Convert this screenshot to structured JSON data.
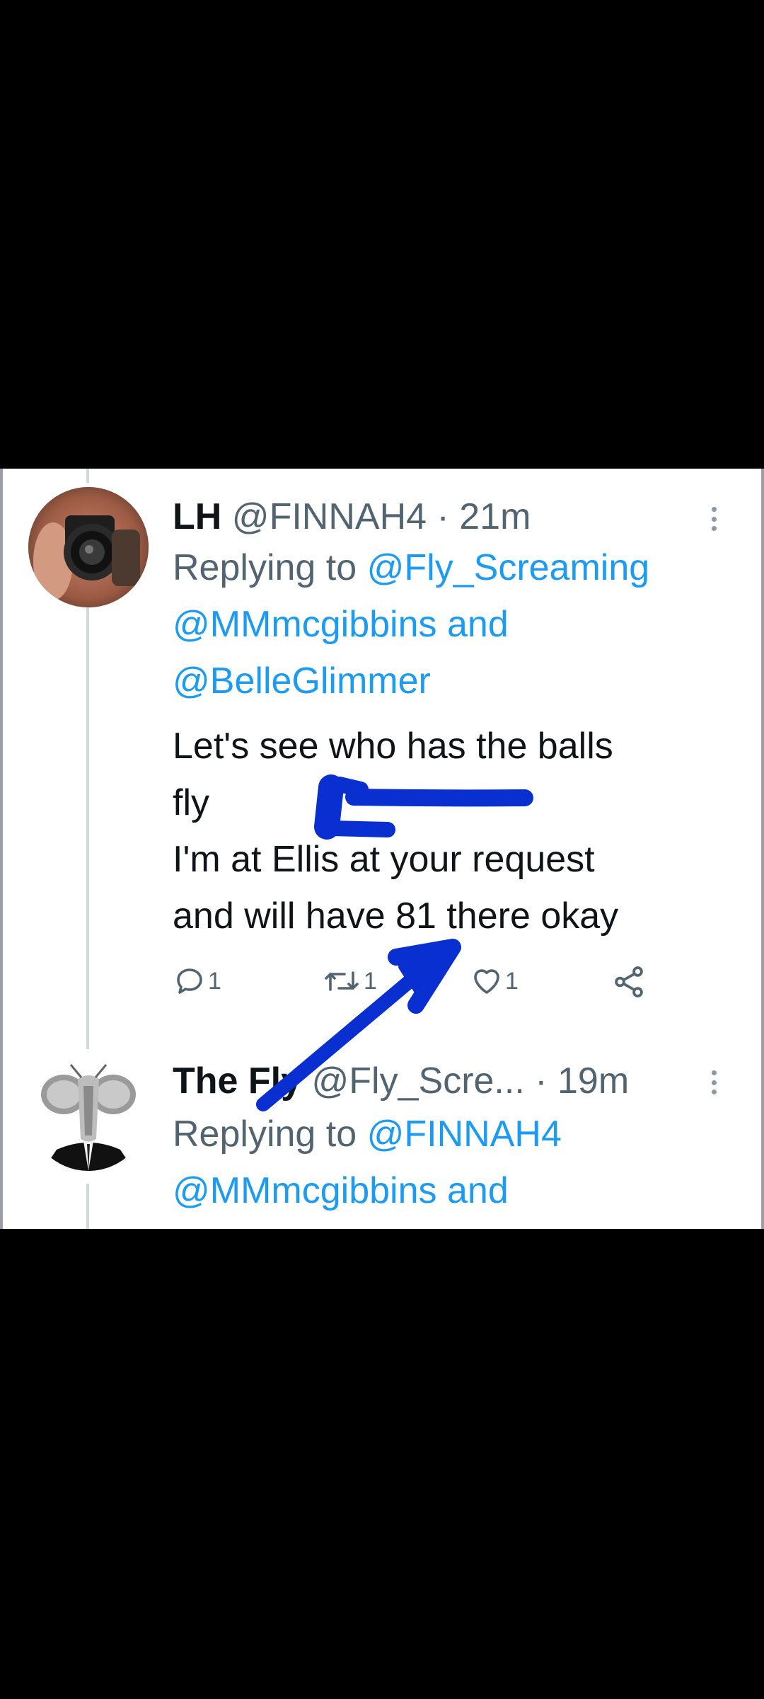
{
  "tweet1": {
    "name": "LH",
    "handle": "@FINNAH4",
    "separator": " · ",
    "time": "21m",
    "replying_prefix": "Replying to ",
    "mention_1": "@Fly_Screaming",
    "mention_2": "@MMmcgibbins",
    "and_word": " and",
    "mention_3": "@BelleGlimmer",
    "text_lines": [
      "Let's see who has the balls",
      "fly",
      "I'm at Ellis at your request",
      "and will have 81 there okay"
    ],
    "reply_count": "1",
    "retweet_count": "1",
    "like_count": "1"
  },
  "tweet2": {
    "name": "The Fly",
    "handle": "@Fly_Scre...",
    "separator": " · ",
    "time": "19m",
    "replying_prefix": "Replying to ",
    "mention_1": "@FINNAH4",
    "mention_2": "@MMmcgibbins",
    "and_word": " and"
  },
  "colors": {
    "mention_blue": "#1d9bf0",
    "annotation_blue": "#0a2fd0",
    "secondary_text": "#536471",
    "primary_text": "#0f1419"
  },
  "icons": {
    "reply": "reply-icon",
    "retweet": "retweet-icon",
    "like": "heart-icon",
    "share": "share-icon",
    "more": "more-options-icon"
  }
}
